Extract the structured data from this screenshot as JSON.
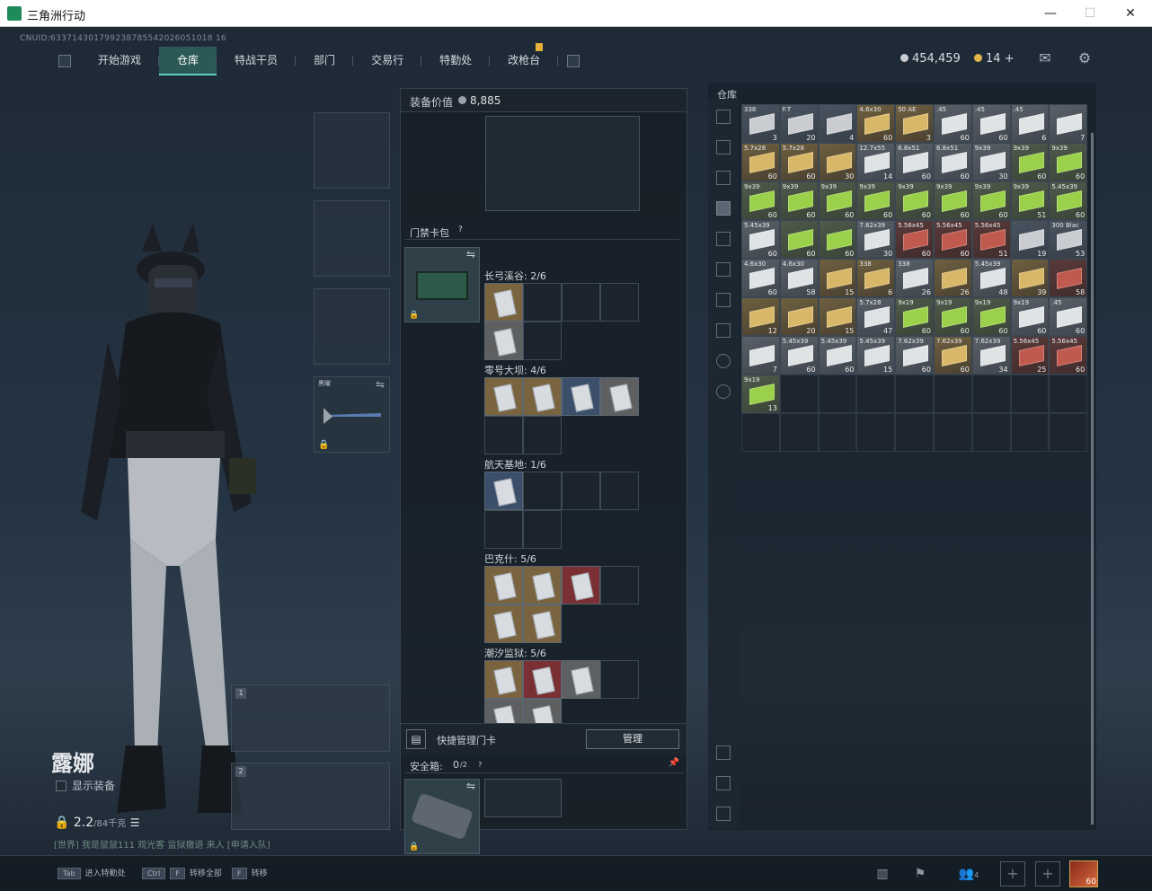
{
  "window": {
    "title": "三角洲行动",
    "minimize": "—",
    "maximize": "☐",
    "close": "✕"
  },
  "uid": "CNUID:633714301799238785542026051018 16",
  "nav": {
    "tabs": [
      "开始游戏",
      "仓库",
      "特战干员",
      "部门",
      "交易行",
      "特勤处",
      "改枪台"
    ],
    "active": 1
  },
  "currency": {
    "silver": "454,459",
    "gold": "14",
    "plus": "+",
    "silver_color": "#c9cdd1",
    "gold_color": "#e0b64a"
  },
  "icons": {
    "mail": "mail-icon",
    "settings": "gear-icon"
  },
  "character": {
    "name": "露娜",
    "show_equipment": "显示装备",
    "weight": "2.2",
    "weight_cap": "/84千克"
  },
  "chat": {
    "channel": "[世界]",
    "text": "我是鼠鼠111 观光客 监狱撤退 来人 [申请入队]"
  },
  "slots": {
    "w1": "1",
    "w2": "2",
    "melee_label": "黑曜"
  },
  "middle": {
    "equip_value_label": "装备价值",
    "equip_value": "8,885",
    "cardpack_title": "门禁卡包",
    "cardpack_help": "?",
    "maps": [
      {
        "label": "长弓溪谷: 2/6",
        "cards": [
          [
            "o"
          ],
          [
            "g"
          ]
        ]
      },
      {
        "label": "零号大坝: 4/6",
        "cards": [
          [
            "o",
            "o",
            "b",
            "g"
          ],
          []
        ]
      },
      {
        "label": "航天基地: 1/6",
        "cards": [
          [
            "b"
          ],
          []
        ]
      },
      {
        "label": "巴克什: 5/6",
        "cards": [
          [
            "o",
            "o",
            "r"
          ],
          [
            "o",
            "o"
          ]
        ]
      },
      {
        "label": "潮汐监狱: 5/6",
        "cards": [
          [
            "o",
            "r",
            "g"
          ],
          [
            "g",
            "g"
          ]
        ]
      }
    ],
    "quick_manage": "快捷管理门卡",
    "manage_btn": "管理",
    "safe_title": "安全箱:",
    "safe_count": "0",
    "safe_cap": "/2",
    "safe_help": "?"
  },
  "stash": {
    "title": "仓库",
    "items": [
      [
        "s",
        "338",
        "3"
      ],
      [
        "s",
        "F.T",
        "20"
      ],
      [
        "s",
        "",
        "4"
      ],
      [
        "y",
        "4.6x30",
        "60"
      ],
      [
        "y",
        "50 AE",
        "3"
      ],
      [
        "w",
        ".45",
        "60"
      ],
      [
        "w",
        ".45",
        "60"
      ],
      [
        "w",
        ".45",
        "6"
      ],
      [
        "w",
        "",
        "7"
      ],
      [
        "y",
        "5.7x28",
        "60"
      ],
      [
        "y",
        "5.7x28",
        "60"
      ],
      [
        "y",
        "",
        "30"
      ],
      [
        "w",
        "12.7x55",
        "14"
      ],
      [
        "w",
        "6.8x51",
        "60"
      ],
      [
        "w",
        "6.8x51",
        "60"
      ],
      [
        "w",
        "9x39",
        "30"
      ],
      [
        "gr",
        "9x39",
        "60"
      ],
      [
        "gr",
        "9x39",
        "60"
      ],
      [
        "gr",
        "9x39",
        "60"
      ],
      [
        "gr",
        "9x39",
        "60"
      ],
      [
        "gr",
        "9x39",
        "60"
      ],
      [
        "gr",
        "9x39",
        "60"
      ],
      [
        "gr",
        "9x39",
        "60"
      ],
      [
        "gr",
        "9x39",
        "60"
      ],
      [
        "gr",
        "9x39",
        "60"
      ],
      [
        "gr",
        "9x39",
        "51"
      ],
      [
        "gr",
        "5.45x39",
        "60"
      ],
      [
        "w",
        "5.45x39",
        "60"
      ],
      [
        "gr",
        "",
        "60"
      ],
      [
        "gr",
        "",
        "60"
      ],
      [
        "w",
        "7.62x39",
        "30"
      ],
      [
        "rd",
        "5.56x45",
        "60"
      ],
      [
        "rd",
        "5.56x45",
        "60"
      ],
      [
        "rd",
        "5.56x45",
        "51"
      ],
      [
        "s",
        "",
        "19"
      ],
      [
        "s",
        "300 Blac",
        "53"
      ],
      [
        "w",
        "4.6x30",
        "60"
      ],
      [
        "w",
        "4.6x30",
        "58"
      ],
      [
        "y",
        "",
        "15"
      ],
      [
        "y",
        "338",
        "6"
      ],
      [
        "w",
        "338",
        "26"
      ],
      [
        "y",
        "",
        "26"
      ],
      [
        "w",
        "5.45x39",
        "48"
      ],
      [
        "y",
        "",
        "39"
      ],
      [
        "rd",
        "",
        "58"
      ],
      [
        "y",
        "",
        "12"
      ],
      [
        "y",
        "",
        "20"
      ],
      [
        "y",
        "",
        "15"
      ],
      [
        "w",
        "5.7x28",
        "47"
      ],
      [
        "gr",
        "9x19",
        "60"
      ],
      [
        "gr",
        "9x19",
        "60"
      ],
      [
        "gr",
        "9x19",
        "60"
      ],
      [
        "w",
        "9x19",
        "60"
      ],
      [
        "w",
        ".45",
        "60"
      ],
      [
        "w",
        "",
        "7"
      ],
      [
        "w",
        "5.45x39",
        "60"
      ],
      [
        "w",
        "5.45x39",
        "60"
      ],
      [
        "w",
        "5.45x39",
        "15"
      ],
      [
        "w",
        "7.62x39",
        "60"
      ],
      [
        "y",
        "7.62x39",
        "60"
      ],
      [
        "w",
        "7.62x39",
        "34"
      ],
      [
        "rd",
        "5.56x45",
        "25"
      ],
      [
        "rd",
        "5.56x45",
        "60"
      ],
      [
        "gr",
        "9x19",
        "13"
      ]
    ]
  },
  "bottom": {
    "hints": [
      [
        "Tab",
        "进入特勤处"
      ],
      [
        "Ctrl",
        "F",
        "转移全部"
      ],
      [
        "F",
        "转移"
      ]
    ],
    "friends": "4",
    "level": "60"
  }
}
